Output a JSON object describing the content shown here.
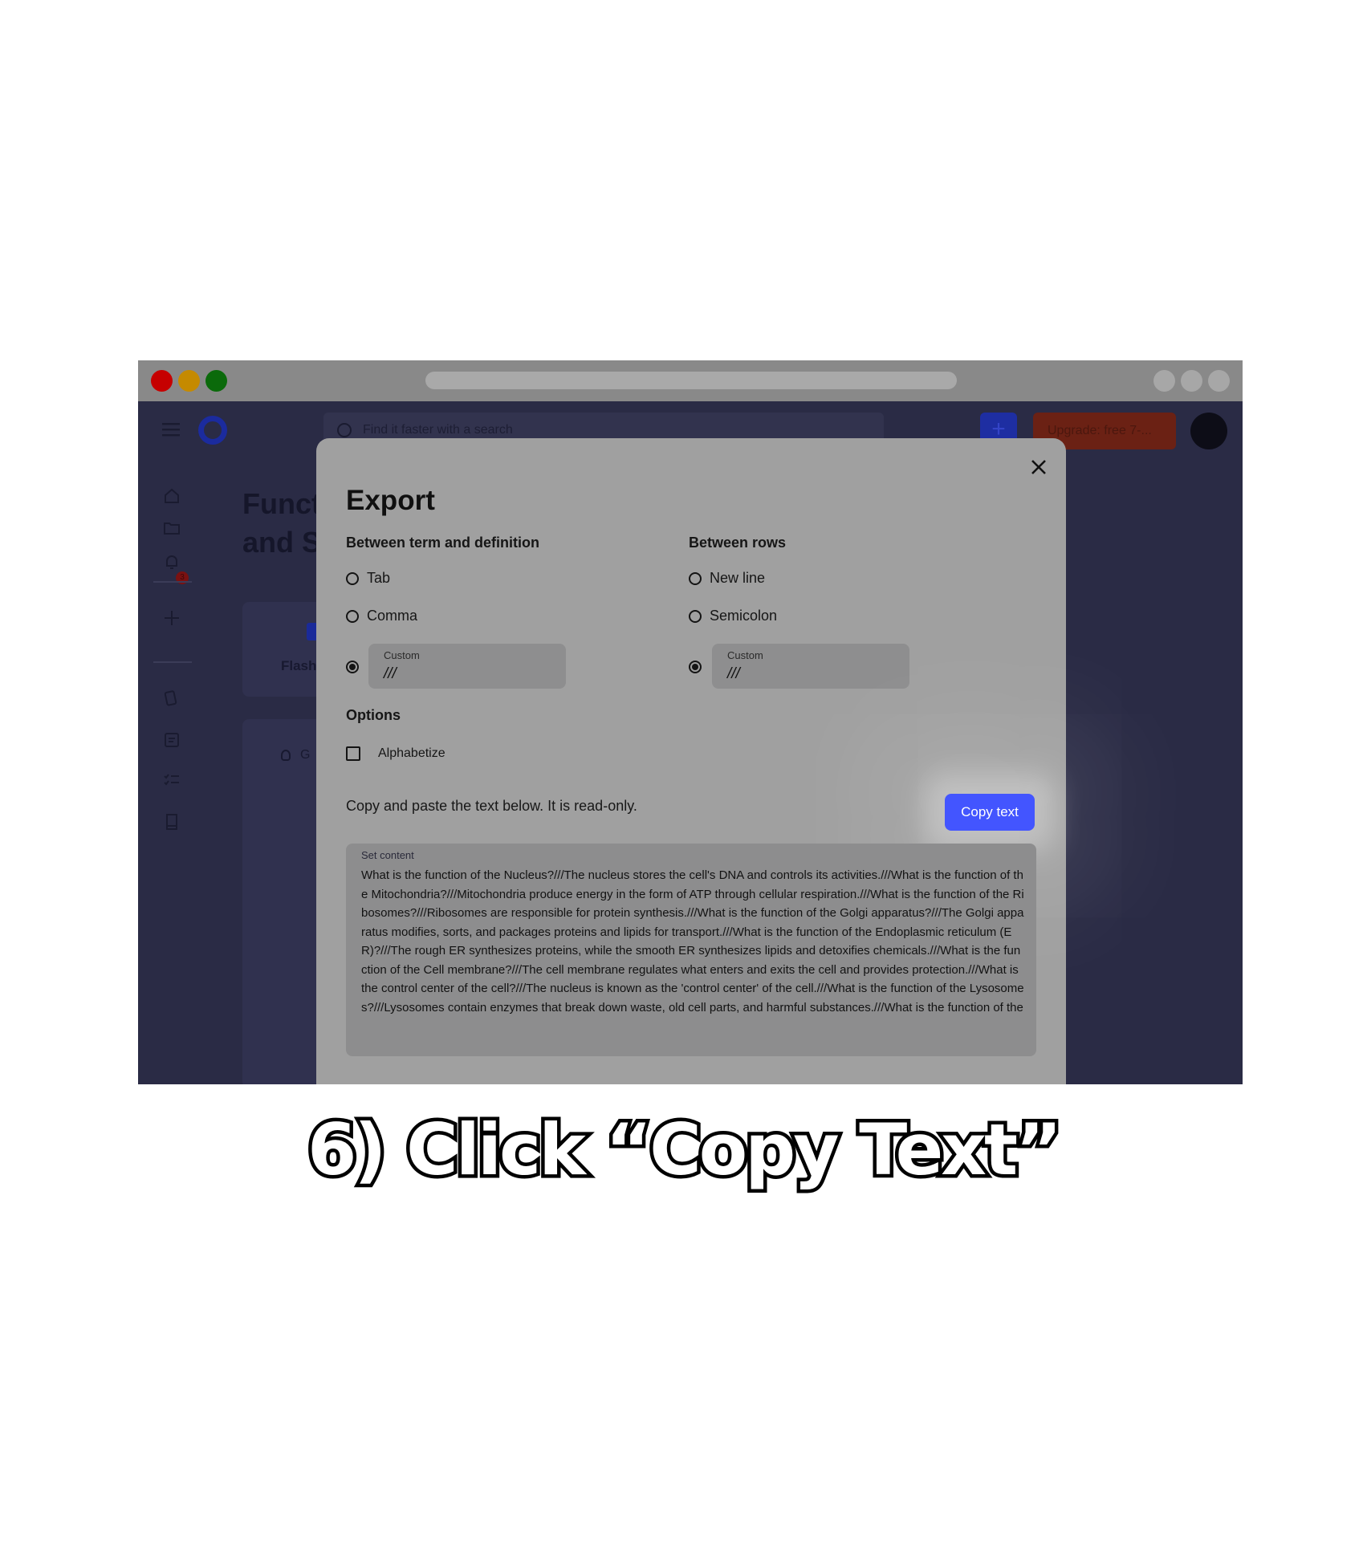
{
  "search": {
    "placeholder": "Find it faster with a search"
  },
  "header": {
    "add_icon": "+",
    "upgrade_label": "Upgrade: free 7-..."
  },
  "sidebar": {
    "notification_count": "3"
  },
  "page": {
    "title_line1": "Funct",
    "title_line2": "and S",
    "card1_label": "Flash",
    "card2_label": "G"
  },
  "modal": {
    "title": "Export",
    "close_glyph": "×",
    "term_section": "Between term and definition",
    "row_section": "Between rows",
    "term_options": [
      "Tab",
      "Comma"
    ],
    "row_options": [
      "New line",
      "Semicolon"
    ],
    "custom_label": "Custom",
    "custom_term_value": "///",
    "custom_row_value": "///",
    "options_title": "Options",
    "alphabetize_label": "Alphabetize",
    "instructions": "Copy and paste the text below. It is read-only.",
    "copy_button": "Copy text",
    "content_label": "Set content",
    "content_text": "What is the function of the Nucleus?///The nucleus stores the cell's DNA and controls its activities.///What is the function of the Mitochondria?///Mitochondria produce energy in the form of ATP through cellular respiration.///What is the function of the Ribosomes?///Ribosomes are responsible for protein synthesis.///What is the function of the Golgi apparatus?///The Golgi apparatus modifies, sorts, and packages proteins and lipids for transport.///What is the function of the Endoplasmic reticulum (ER)?///The rough ER synthesizes proteins, while the smooth ER synthesizes lipids and detoxifies chemicals.///What is the function of the Cell membrane?///The cell membrane regulates what enters and exits the cell and provides protection.///What is the control center of the cell?///The nucleus is known as the 'control center' of the cell.///What is the function of the Lysosomes?///Lysosomes contain enzymes that break down waste, old cell parts, and harmful substances.///What is the function of the"
  },
  "caption": "6) Click “Copy Text”",
  "colors": {
    "accent": "#4355ff",
    "overlay_bg": "#2a2b45",
    "modal_bg": "#a0a0a0"
  }
}
